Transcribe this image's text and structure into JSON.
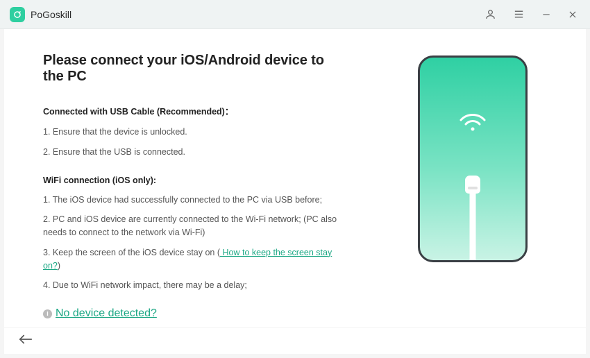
{
  "brand": {
    "name": "PoGoskill"
  },
  "heading": "Please connect your iOS/Android device to the PC",
  "usb": {
    "title": "Connected with USB Cable (Recommended)：",
    "step1": "1. Ensure that the device is unlocked.",
    "step2": "2. Ensure that the USB is connected."
  },
  "wifi": {
    "title": "WiFi connection (iOS only):",
    "step1": "1. The iOS device had successfully connected to the PC via USB before;",
    "step2": "2. PC and iOS device are currently connected to the Wi-Fi network; (PC also needs to connect to the network via Wi-Fi)",
    "step3_prefix": "3. Keep the screen of the iOS device stay on  (",
    "step3_link": " How to keep the screen stay on?",
    "step3_suffix": ")",
    "step4": "4. Due to WiFi network impact, there may be a delay;"
  },
  "noDevice": "No device detected?"
}
